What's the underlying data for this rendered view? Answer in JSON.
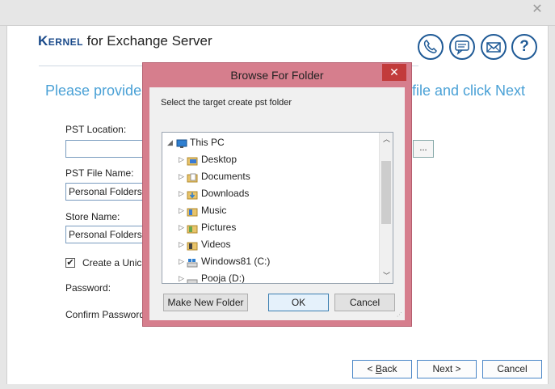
{
  "window": {
    "close_glyph": "✕"
  },
  "header": {
    "logo_brand": "Kernel",
    "logo_rest": " for Exchange Server",
    "icons": [
      "phone-icon",
      "chat-icon",
      "mail-icon",
      "help-icon"
    ],
    "help_glyph": "?"
  },
  "main": {
    "instruction_left": "Please provide",
    "instruction_right": "file and click Next",
    "pst_location_label": "PST Location:",
    "pst_location_value": "",
    "browse_label": "...",
    "pst_file_label": "PST File Name:",
    "pst_file_value": "Personal Folders.pst",
    "store_name_label": "Store Name:",
    "store_name_value": "Personal Folders",
    "checkbox_mark": "✔",
    "create_label": "Create a Unic",
    "password_label": "Password:",
    "confirm_password_label": "Confirm Password:"
  },
  "nav": {
    "back_label": "< Back",
    "back_accel": "B",
    "next_label": "Next >",
    "cancel_label": "Cancel"
  },
  "dialog": {
    "title": "Browse For Folder",
    "close_glyph": "✕",
    "prompt": "Select the target create pst folder",
    "tree": [
      {
        "label": "This PC",
        "icon": "computer-icon",
        "expanded": true
      },
      {
        "label": "Desktop",
        "icon": "desktop-folder-icon"
      },
      {
        "label": "Documents",
        "icon": "documents-folder-icon"
      },
      {
        "label": "Downloads",
        "icon": "downloads-folder-icon"
      },
      {
        "label": "Music",
        "icon": "music-folder-icon"
      },
      {
        "label": "Pictures",
        "icon": "pictures-folder-icon"
      },
      {
        "label": "Videos",
        "icon": "videos-folder-icon"
      },
      {
        "label": "Windows81 (C:)",
        "icon": "drive-icon"
      },
      {
        "label": "Pooja (D:)",
        "icon": "drive-icon"
      }
    ],
    "make_folder_label": "Make New Folder",
    "ok_label": "OK",
    "cancel_label": "Cancel"
  },
  "colors": {
    "dialog_frame": "#d67e8d",
    "accent_blue": "#4aa1d6",
    "icon_ring": "#1f5a96",
    "close_red": "#c23b3b"
  }
}
